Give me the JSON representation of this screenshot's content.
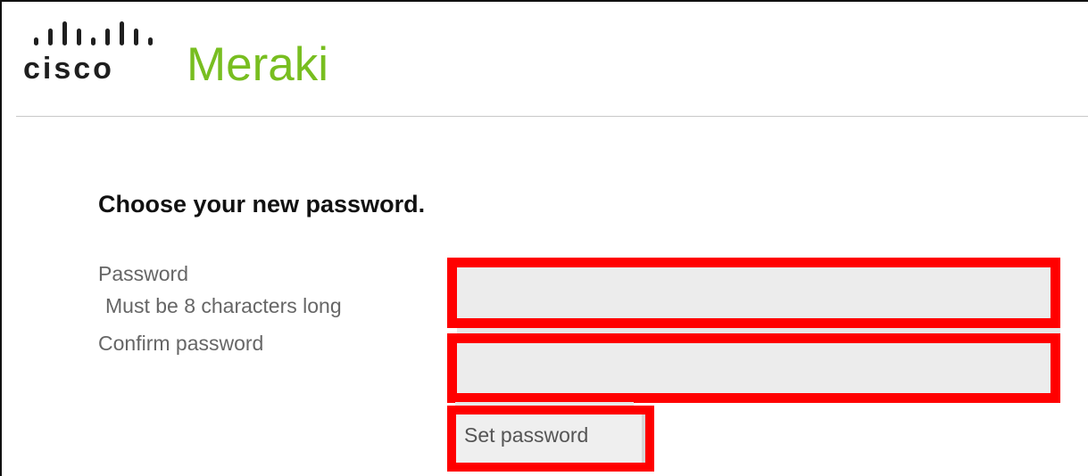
{
  "header": {
    "cisco_logo_text": "cisco",
    "product_name": "Meraki"
  },
  "form": {
    "title": "Choose your new password.",
    "password_label": "Password",
    "password_hint": "Must be 8 characters long",
    "password_value": "",
    "confirm_label": "Confirm password",
    "confirm_value": "",
    "submit_label": "Set password"
  },
  "colors": {
    "brand_green": "#78be20",
    "highlight_red": "#ff0000",
    "field_background": "#ececec"
  }
}
